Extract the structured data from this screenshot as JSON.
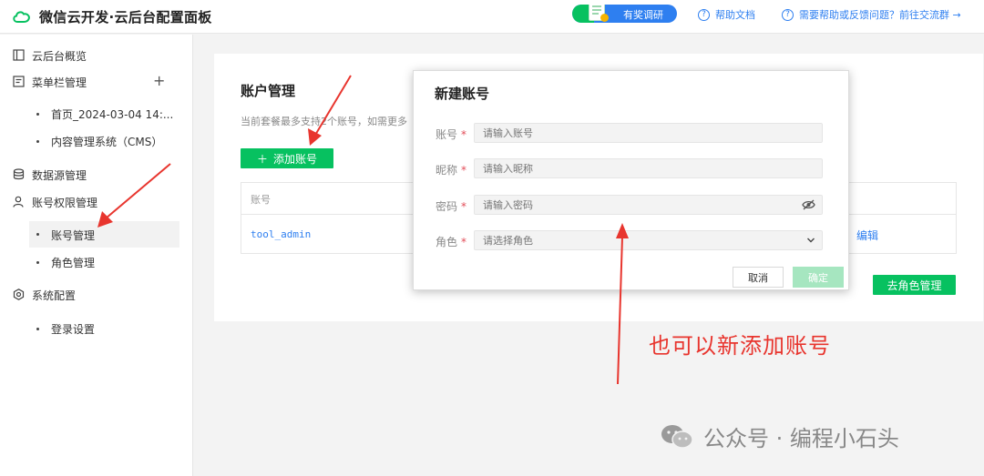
{
  "header": {
    "app_title": "微信云开发·云后台配置面板",
    "survey_label": "有奖调研",
    "help_doc": "帮助文档",
    "help_group": "需要帮助或反馈问题？前往交流群 →"
  },
  "sidebar": {
    "overview": "云后台概览",
    "menu_mgmt": "菜单栏管理",
    "menu_children": [
      "首页_2024-03-04 14:...",
      "内容管理系统（CMS）"
    ],
    "datasource": "数据源管理",
    "permissions": "账号权限管理",
    "perm_children": [
      "账号管理",
      "角色管理"
    ],
    "system": "系统配置",
    "system_children": [
      "登录设置"
    ]
  },
  "main": {
    "title": "账户管理",
    "description": "当前套餐最多支持2个账号，如需更多",
    "add_button": "添加账号",
    "table": {
      "header_account": "账号",
      "rows": [
        {
          "account": "tool_admin",
          "action": "编辑"
        }
      ]
    },
    "role_button": "去角色管理"
  },
  "modal": {
    "title": "新建账号",
    "fields": [
      {
        "label": "账号",
        "placeholder": "请输入账号"
      },
      {
        "label": "昵称",
        "placeholder": "请输入昵称"
      },
      {
        "label": "密码",
        "placeholder": "请输入密码"
      },
      {
        "label": "角色",
        "placeholder": "请选择角色"
      }
    ],
    "required_mark": "*",
    "cancel": "取消",
    "confirm": "确定"
  },
  "annotation": "也可以新添加账号",
  "watermark": "公众号 · 编程小石头",
  "colors": {
    "brand_green": "#07c160",
    "link_blue": "#2e7ff0",
    "annotation_red": "#e8352e"
  }
}
